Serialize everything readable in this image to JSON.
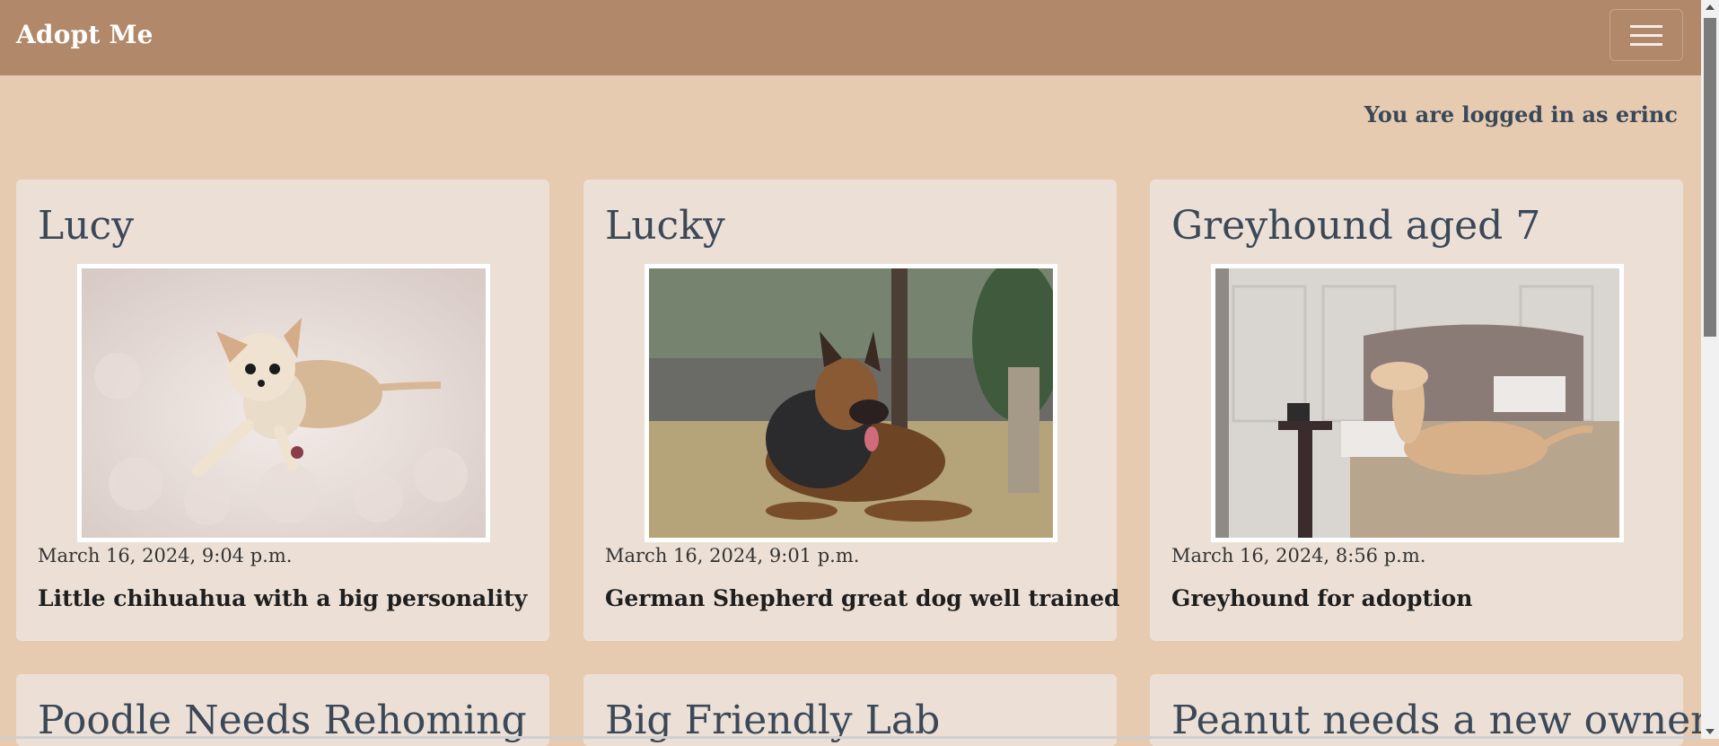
{
  "brand": "Adopt Me",
  "nav": {
    "menu_icon": "hamburger-icon"
  },
  "login_text": "You are logged in as erinc",
  "posts": [
    {
      "title": "Lucy",
      "date": "March 16, 2024, 9:04 p.m.",
      "description": "Little chihuahua with a big personality"
    },
    {
      "title": "Lucky",
      "date": "March 16, 2024, 9:01 p.m.",
      "description": "German Shepherd great dog well trained"
    },
    {
      "title": "Greyhound aged 7",
      "date": "March 16, 2024, 8:56 p.m.",
      "description": "Greyhound for adoption"
    },
    {
      "title": "Poodle Needs Rehoming"
    },
    {
      "title": "Big Friendly Lab"
    },
    {
      "title": "Peanut needs a new owner"
    }
  ],
  "colors": {
    "navbar": "#b1886a",
    "page_bg": "#e6cbb0",
    "card_bg": "#ece0d6",
    "heading": "#3b4858"
  }
}
